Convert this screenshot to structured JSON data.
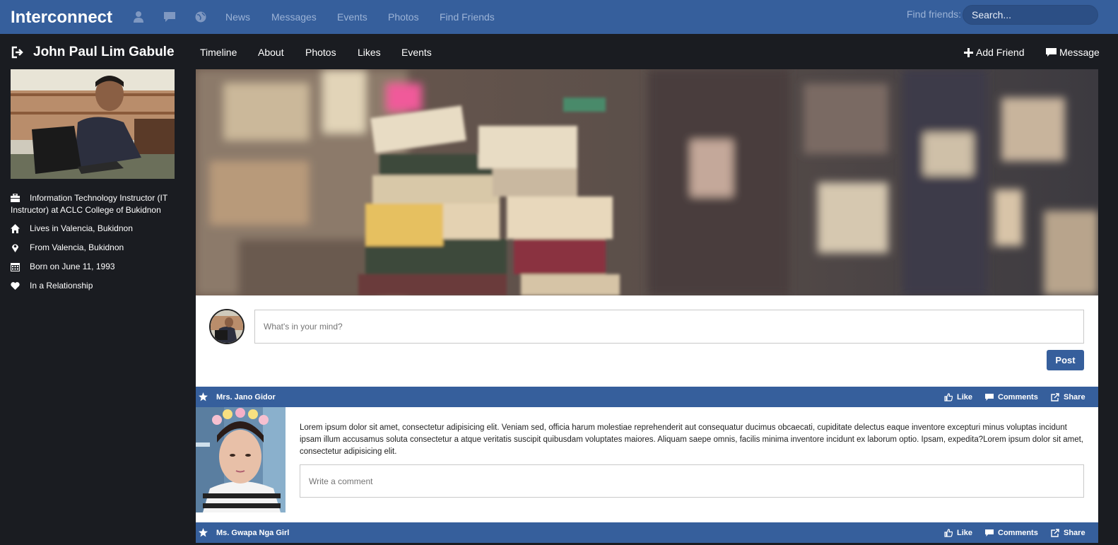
{
  "navbar": {
    "brand": "Interconnect",
    "links": [
      "News",
      "Messages",
      "Events",
      "Photos",
      "Find Friends"
    ],
    "find_label": "Find friends:",
    "search_placeholder": "Search...",
    "icons": [
      "user-icon",
      "chat-icon",
      "globe-icon"
    ]
  },
  "profile": {
    "name": "John Paul Lim Gabule",
    "tabs": [
      "Timeline",
      "About",
      "Photos",
      "Likes",
      "Events"
    ],
    "actions": {
      "add_friend": "Add Friend",
      "message": "Message"
    }
  },
  "sidebar": {
    "info": [
      {
        "icon": "briefcase-icon",
        "text": "Information Technology Instructor (IT Instructor) at ACLC College of Bukidnon"
      },
      {
        "icon": "home-icon",
        "text": "Lives in Valencia, Bukidnon"
      },
      {
        "icon": "map-marker-icon",
        "text": "From Valencia, Bukidnon"
      },
      {
        "icon": "calendar-icon",
        "text": "Born on June 11, 1993"
      },
      {
        "icon": "heart-icon",
        "text": "In a Relationship"
      }
    ]
  },
  "composer": {
    "placeholder": "What's in your mind?",
    "post_label": "Post"
  },
  "posts": [
    {
      "author": "Mrs. Jano Gidor",
      "text": "Lorem ipsum dolor sit amet, consectetur adipisicing elit. Veniam sed, officia harum molestiae reprehenderit aut consequatur ducimus obcaecati, cupiditate delectus eaque inventore excepturi minus voluptas incidunt ipsam illum accusamus soluta consectetur a atque veritatis suscipit quibusdam voluptates maiores. Aliquam saepe omnis, facilis minima inventore incidunt ex laborum optio. Ipsam, expedita?Lorem ipsum dolor sit amet, consectetur adipisicing elit.",
      "comment_placeholder": "Write a comment"
    },
    {
      "author": "Ms. Gwapa Nga Girl"
    }
  ],
  "post_actions": {
    "like": "Like",
    "comments": "Comments",
    "share": "Share"
  },
  "colors": {
    "navbar": "#365f9c",
    "background": "#1a1c21",
    "card": "#ffffff"
  }
}
